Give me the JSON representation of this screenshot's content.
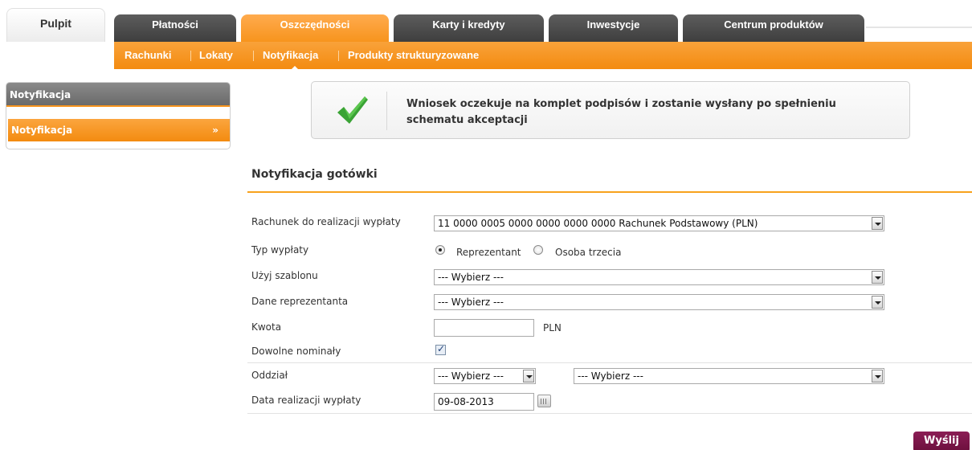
{
  "tabs": [
    {
      "label": "Pulpit"
    },
    {
      "label": "Płatności"
    },
    {
      "label": "Oszczędności"
    },
    {
      "label": "Karty i kredyty"
    },
    {
      "label": "Inwestycje"
    },
    {
      "label": "Centrum produktów"
    }
  ],
  "subnav": [
    "Rachunki",
    "Lokaty",
    "Notyfikacja",
    "Produkty strukturyzowane"
  ],
  "sidebar": {
    "title": "Notyfikacja",
    "item": "Notyfikacja",
    "arrow": "»"
  },
  "message": {
    "text": "Wniosek oczekuje na komplet podpisów i zostanie wysłany po spełnieniu schematu akceptacji",
    "icon": "checkmark-icon"
  },
  "form": {
    "title": "Notyfikacja gotówki",
    "account_label": "Rachunek do realizacji wypłaty",
    "account_value": "11 0000 0005 0000 0000 0000 0000 Rachunek Podstawowy (PLN)",
    "type_label": "Typ wypłaty",
    "type_options": [
      "Reprezentant",
      "Osoba trzecia"
    ],
    "template_label": "Użyj szablonu",
    "template_value": "--- Wybierz ---",
    "rep_label": "Dane reprezentanta",
    "rep_value": "--- Wybierz ---",
    "amount_label": "Kwota",
    "amount_value": "",
    "currency": "PLN",
    "nominals_label": "Dowolne nominały",
    "branch_label": "Oddział",
    "branch_value1": "--- Wybierz ---",
    "branch_value2": "--- Wybierz ---",
    "date_label": "Data realizacji wypłaty",
    "date_value": "09-08-2013",
    "submit": "Wyślij"
  },
  "colors": {
    "accent": "#f7941d",
    "submit": "#7a1446"
  }
}
